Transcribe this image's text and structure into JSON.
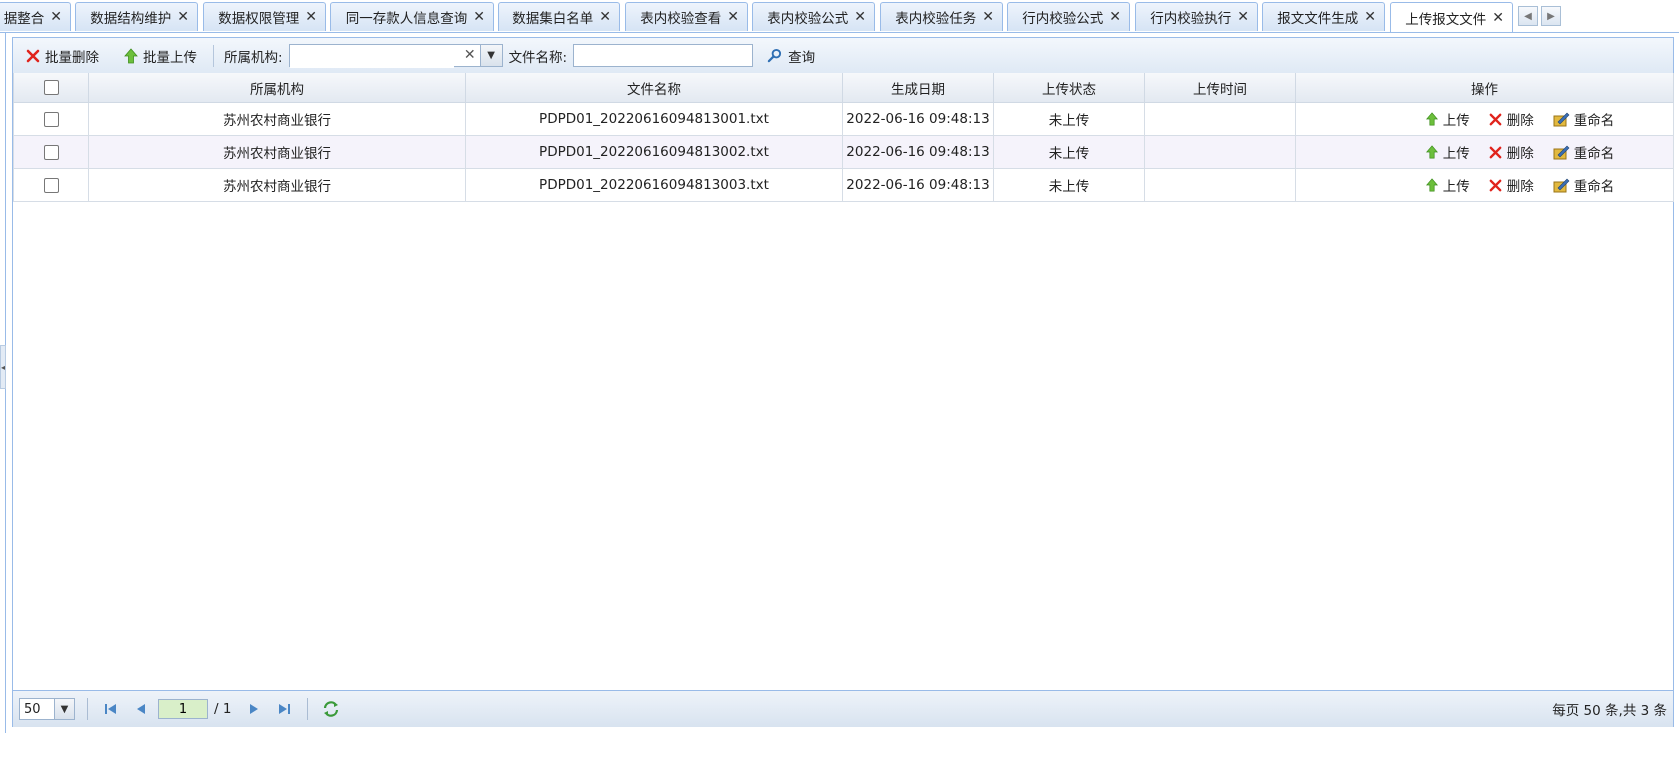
{
  "tabs": [
    {
      "label": "据整合",
      "active": false
    },
    {
      "label": "数据结构维护",
      "active": false
    },
    {
      "label": "数据权限管理",
      "active": false
    },
    {
      "label": "同一存款人信息查询",
      "active": false
    },
    {
      "label": "数据集白名单",
      "active": false
    },
    {
      "label": "表内校验查看",
      "active": false
    },
    {
      "label": "表内校验公式",
      "active": false
    },
    {
      "label": "表内校验任务",
      "active": false
    },
    {
      "label": "行内校验公式",
      "active": false
    },
    {
      "label": "行内校验执行",
      "active": false
    },
    {
      "label": "报文文件生成",
      "active": false
    },
    {
      "label": "上传报文文件",
      "active": true
    }
  ],
  "toolbar": {
    "batch_delete_label": "批量删除",
    "batch_upload_label": "批量上传",
    "org_label": "所属机构:",
    "org_value": "",
    "filename_label": "文件名称:",
    "filename_value": "",
    "query_label": "查询"
  },
  "grid": {
    "columns": [
      "所属机构",
      "文件名称",
      "生成日期",
      "上传状态",
      "上传时间",
      "操作"
    ],
    "rows": [
      {
        "org": "苏州农村商业银行",
        "file": "PDPD01_20220616094813001.txt",
        "date": "2022-06-16 09:48:13",
        "status": "未上传",
        "upload_time": ""
      },
      {
        "org": "苏州农村商业银行",
        "file": "PDPD01_20220616094813002.txt",
        "date": "2022-06-16 09:48:13",
        "status": "未上传",
        "upload_time": ""
      },
      {
        "org": "苏州农村商业银行",
        "file": "PDPD01_20220616094813003.txt",
        "date": "2022-06-16 09:48:13",
        "status": "未上传",
        "upload_time": ""
      }
    ],
    "actions": {
      "upload": "上传",
      "delete": "删除",
      "rename": "重命名"
    }
  },
  "pager": {
    "page_size": "50",
    "current_page": "1",
    "total_pages": "/ 1",
    "summary": "每页 50 条,共 3 条"
  },
  "colors": {
    "border": "#99bbe8",
    "header_bg": "#dfe9f5",
    "alt_row": "#f5f3fb"
  }
}
